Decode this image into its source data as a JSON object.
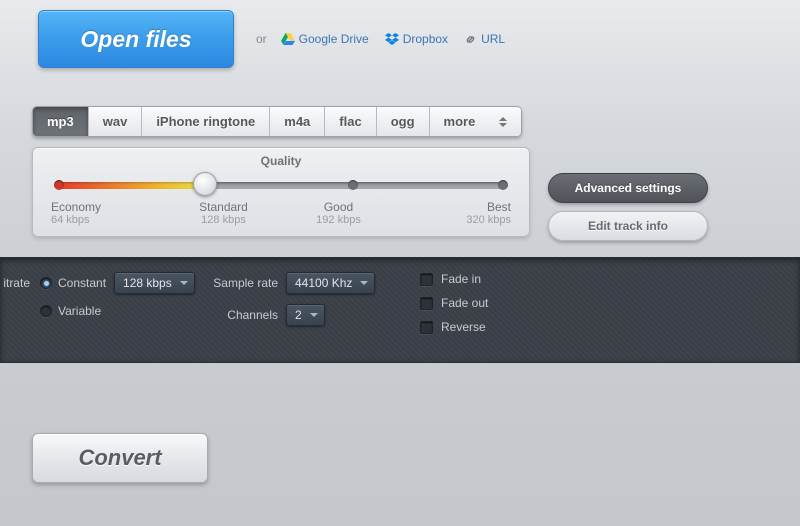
{
  "top": {
    "open_label": "Open files",
    "or": "or",
    "gdrive": "Google Drive",
    "dropbox": "Dropbox",
    "url": "URL"
  },
  "formats": {
    "items": [
      "mp3",
      "wav",
      "iPhone ringtone",
      "m4a",
      "flac",
      "ogg",
      "more"
    ],
    "active_index": 0
  },
  "quality": {
    "title": "Quality",
    "stops": [
      {
        "name": "Economy",
        "bitrate": "64 kbps"
      },
      {
        "name": "Standard",
        "bitrate": "128 kbps"
      },
      {
        "name": "Good",
        "bitrate": "192 kbps"
      },
      {
        "name": "Best",
        "bitrate": "320 kbps"
      }
    ],
    "selected_index": 1
  },
  "side": {
    "advanced": "Advanced settings",
    "edit_info": "Edit track info"
  },
  "advanced": {
    "bitrate_label": "itrate",
    "constant": "Constant",
    "variable": "Variable",
    "bitrate_value": "128 kbps",
    "bitrate_mode": "constant",
    "sample_rate_label": "Sample rate",
    "sample_rate_value": "44100 Khz",
    "channels_label": "Channels",
    "channels_value": "2",
    "fade_in": "Fade in",
    "fade_out": "Fade out",
    "reverse": "Reverse",
    "fade_in_checked": false,
    "fade_out_checked": false,
    "reverse_checked": false
  },
  "convert": {
    "label": "Convert"
  }
}
